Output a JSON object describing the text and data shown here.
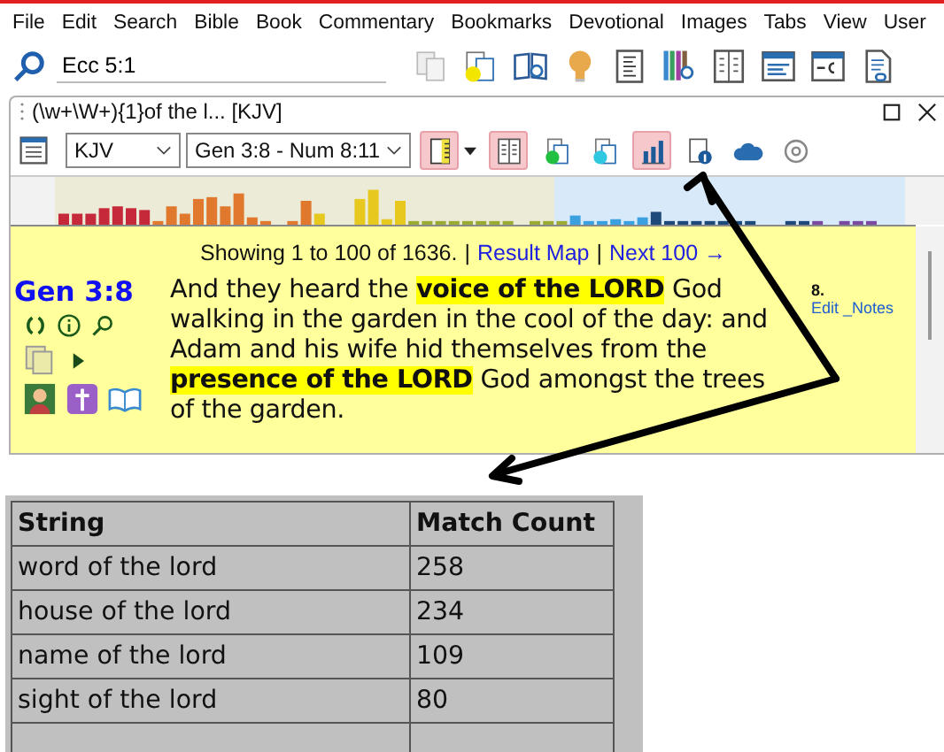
{
  "menu": [
    "File",
    "Edit",
    "Search",
    "Bible",
    "Book",
    "Commentary",
    "Bookmarks",
    "Devotional",
    "Images",
    "Tabs",
    "View",
    "User"
  ],
  "search": {
    "value": "Ecc 5:1"
  },
  "panel": {
    "title": "(\\w+\\W+){1}of the l... [KJV]"
  },
  "toolbar": {
    "version": "KJV",
    "range": "Gen 3:8 - Num 8:11",
    "buttons": [
      {
        "kind": "ruler",
        "selected": true
      },
      {
        "kind": "dropdown",
        "selected": false
      },
      {
        "kind": "columns",
        "selected": true
      },
      {
        "kind": "vl",
        "selected": false
      },
      {
        "kind": "vr",
        "selected": false
      },
      {
        "kind": "chart",
        "selected": true
      },
      {
        "kind": "info",
        "selected": false
      },
      {
        "kind": "cloud",
        "selected": false
      },
      {
        "kind": "disc",
        "selected": false
      }
    ]
  },
  "results": {
    "summary": "Showing 1 to 100 of 1636.",
    "separator_1": "|",
    "result_map": "Result Map",
    "separator_2": "|",
    "next": "Next 100 →"
  },
  "verse": {
    "ref": "Gen 3:8",
    "text": "And they heard the **voice of the LORD** God walking in the garden in the cool of the day: and Adam and his wife hid themselves from the **presence of the LORD** God amongst the trees of the garden.",
    "note_number": "8.",
    "note_link": "Edit _Notes"
  },
  "table": {
    "columns": [
      "String",
      "Match Count"
    ],
    "rows": [
      [
        "word of the lord",
        "258"
      ],
      [
        "house of the lord",
        "234"
      ],
      [
        "name of the lord",
        "109"
      ],
      [
        "sight of the lord",
        "80"
      ]
    ]
  }
}
